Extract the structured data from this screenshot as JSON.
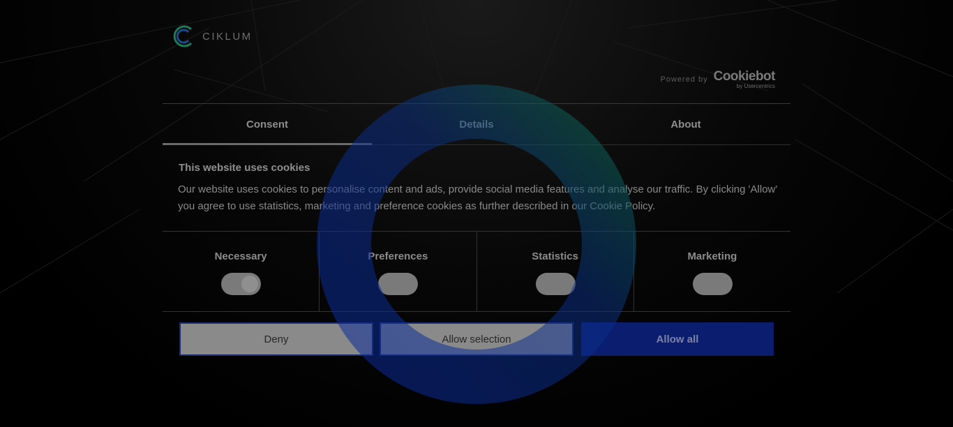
{
  "brand": {
    "logo_text": "CIKLUM",
    "logo_icon": "ciklum-logo-icon"
  },
  "powered_by": {
    "label": "Powered by",
    "vendor": "Cookiebot",
    "vendor_sub": "by Usercentrics"
  },
  "tabs": [
    {
      "label": "Consent",
      "active": true
    },
    {
      "label": "Details",
      "active": false
    },
    {
      "label": "About",
      "active": false
    }
  ],
  "consent": {
    "heading": "This website uses cookies",
    "body": "Our website uses cookies to personalise content and ads, provide social media features and analyse our traffic. By clicking 'Allow' you agree to use statistics, marketing and preference cookies as further described in our Cookie Policy."
  },
  "toggles": [
    {
      "label": "Necessary",
      "on": true
    },
    {
      "label": "Preferences",
      "on": false
    },
    {
      "label": "Statistics",
      "on": false
    },
    {
      "label": "Marketing",
      "on": false
    }
  ],
  "buttons": {
    "deny": "Deny",
    "allow_selection": "Allow selection",
    "allow_all": "Allow all"
  },
  "colors": {
    "overlay": "#000000",
    "primary": "#0b1d6e",
    "ring_blue": "#0a2a9c",
    "ring_green": "#0c6a4a"
  },
  "loading_indicator": "spinner-ring"
}
